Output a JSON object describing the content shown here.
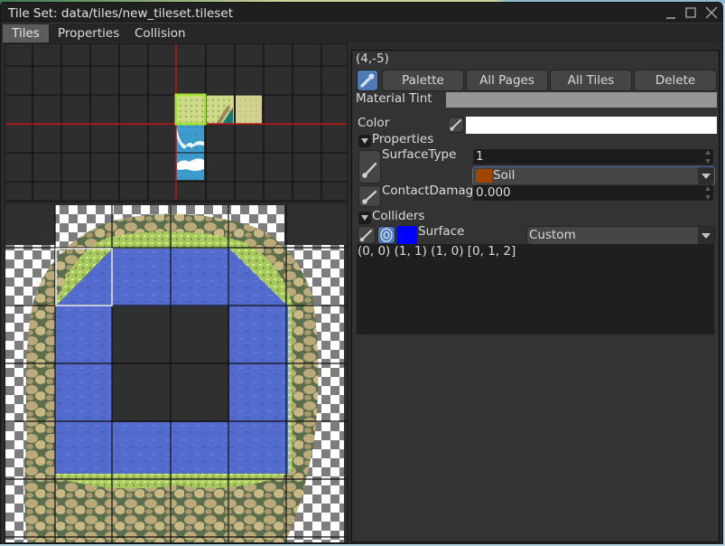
{
  "window": {
    "title": "Tile Set: data/tiles/new_tileset.tileset",
    "controls": [
      "minimize-icon",
      "maximize-icon",
      "close-icon"
    ]
  },
  "tabs": [
    {
      "label": "Tiles",
      "active": true
    },
    {
      "label": "Properties",
      "active": false
    },
    {
      "label": "Collision",
      "active": false
    }
  ],
  "inspector": {
    "coord_label": "(4,-5)",
    "toolbar": {
      "picker_icon": "eyedropper-icon",
      "buttons": [
        "Palette",
        "All Pages",
        "All Tiles",
        "Delete"
      ]
    },
    "material_tint": {
      "label": "Material Tint",
      "value_color": "#969696"
    },
    "color": {
      "label": "Color",
      "value_color": "#ffffff",
      "icon": "brush-icon"
    },
    "properties_section": {
      "label": "Properties",
      "expanded": true,
      "items": [
        {
          "name": "SurfaceType",
          "value": "1",
          "dropdown_value": "Soil",
          "dropdown_swatch": "#a24500"
        },
        {
          "name": "ContactDamage",
          "value": "0.000"
        }
      ]
    },
    "colliders_section": {
      "label": "Colliders",
      "expanded": true,
      "collider": {
        "name": "Surface",
        "color": "#0000ff",
        "shape_value": "Custom"
      },
      "points_text": "(0, 0) (1, 1) (1, 0) [0, 1, 2]"
    }
  },
  "palette_view": {
    "selected_tile_color": "#a6e332",
    "crosshair_color": "#c01414"
  },
  "tile_view": {
    "collider_overlay_color": "#5a6ad6",
    "selection_outline_color": "#e8e8e8"
  }
}
